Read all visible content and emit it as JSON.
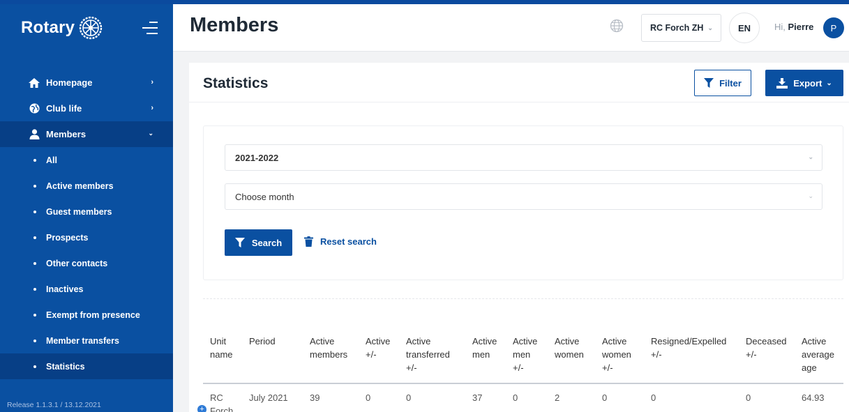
{
  "brand": {
    "name": "Rotary"
  },
  "sidebar": {
    "items": [
      {
        "label": "Homepage"
      },
      {
        "label": "Club life"
      },
      {
        "label": "Members"
      }
    ],
    "subitems": [
      {
        "label": "All"
      },
      {
        "label": "Active members"
      },
      {
        "label": "Guest members"
      },
      {
        "label": "Prospects"
      },
      {
        "label": "Other contacts"
      },
      {
        "label": "Inactives"
      },
      {
        "label": "Exempt from presence"
      },
      {
        "label": "Member transfers"
      },
      {
        "label": "Statistics"
      }
    ],
    "release": "Release 1.1.3.1 / 13.12.2021"
  },
  "header": {
    "title": "Members",
    "club": "RC Forch ZH",
    "language": "EN",
    "greeting": "Hi,",
    "user": "Pierre",
    "avatar_initial": "P"
  },
  "card": {
    "title": "Statistics",
    "filter_label": "Filter",
    "export_label": "Export"
  },
  "filters": {
    "year_value": "2021-2022",
    "month_value": "Choose month",
    "search_label": "Search",
    "reset_label": "Reset search"
  },
  "table": {
    "headers": [
      [
        "Unit",
        "name"
      ],
      [
        "Period"
      ],
      [
        "Active",
        "members"
      ],
      [
        "Active",
        "+/-"
      ],
      [
        "Active",
        "transferred",
        "+/-"
      ],
      [
        "Active",
        "men"
      ],
      [
        "Active",
        "men",
        "+/-"
      ],
      [
        "Active",
        "women"
      ],
      [
        "Active",
        "women",
        "+/-"
      ],
      [
        "Resigned/Expelled",
        "+/-"
      ],
      [
        "Deceased",
        "+/-"
      ],
      [
        "Active",
        "average",
        "age"
      ]
    ],
    "rows": [
      [
        "RC Forch",
        "July 2021",
        "39",
        "0",
        "0",
        "37",
        "0",
        "2",
        "0",
        "0",
        "0",
        "64.93"
      ]
    ]
  },
  "colors": {
    "primary": "#0a50a1",
    "primary_dark": "#073f86",
    "background": "#f2f3f5"
  }
}
